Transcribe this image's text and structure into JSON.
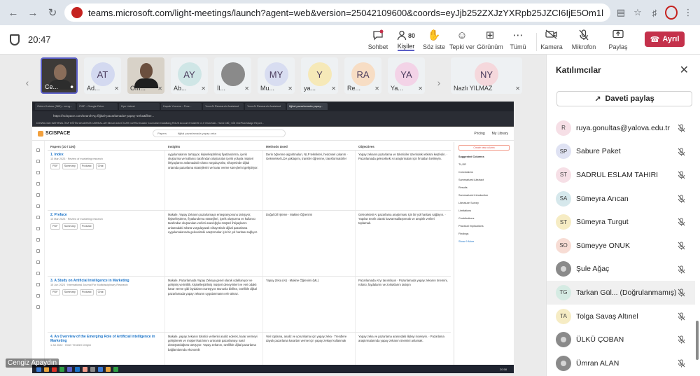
{
  "browser": {
    "url": "teams.microsoft.com/light-meetings/launch?agent=web&version=25042109600&coords=eyJjb252ZXJzYXRpb25JZCI6IjE5Om1lZXRpbmdfWkRVeU1qUTNPRFFF..."
  },
  "toolbar": {
    "timer": "20:47",
    "chat": "Sohbet",
    "people": "Kişiler",
    "people_count": "80",
    "raise": "Söz iste",
    "react": "Tepki ver",
    "view": "Görünüm",
    "more": "Tümü",
    "camera": "Kamera",
    "mic": "Mikrofon",
    "share": "Paylaş",
    "leave": "Ayrıl"
  },
  "strip": [
    {
      "initials": "",
      "name": "Ce...",
      "video": true
    },
    {
      "initials": "AT",
      "name": "Ad...",
      "color": "#d3d9f0"
    },
    {
      "initials": "",
      "name": "Om...",
      "video": true
    },
    {
      "initials": "AY",
      "name": "Ab...",
      "color": "#cfe6e6"
    },
    {
      "initials": "",
      "name": "İl...",
      "photo": true
    },
    {
      "initials": "MY",
      "name": "Mu...",
      "color": "#d8ddf1"
    },
    {
      "initials": "Y",
      "name": "ya...",
      "color": "#f6e9b8"
    },
    {
      "initials": "RA",
      "name": "Re...",
      "color": "#f7ddc4"
    },
    {
      "initials": "YA",
      "name": "Ya...",
      "color": "#f3d3e7"
    }
  ],
  "strip_big": {
    "initials": "NY",
    "name": "Nazlı YILMAZ",
    "color": "#f5d8dc"
  },
  "shared_screen": {
    "presenter": "Cengiz Apaydın",
    "tabs": [
      "Gelen Kutusu (365) - ceng...",
      "İTAP - Google Drive",
      "Üye Listesi",
      "Kapak Yorumu - Pow...",
      "Your AI Research Assistant",
      "Your AI Research Assistant",
      "fiğital pazarlamada yapay..."
    ],
    "address": "https://scispace.com/search?q=fiğital+pazarlamada+yapay+zeka&filter...",
    "bookmarks": "DOWNLOAD   MATERIAL   İTAP   EĞİTİM   AKADEMİK   UMREAL-AR   Mimari   Anket   İhl   AR   CAYRA   Disaster Journalism   DataBang   RGUS Account   EmailOS v1.0   VirusTotal - Home   CBİ | GİS   OnePlusVoltage Report...",
    "logo": "SCISPACE",
    "search_scope": "Papers",
    "query": "fiğital pazarlamada yapay zeka",
    "pricing": "Pricing",
    "library": "My Library",
    "col_papers": "Papers (10 / 100)",
    "col_insights": "Insights",
    "col_methods": "Methods Used",
    "col_objectives": "Objectives",
    "rows": [
      {
        "title": "1. Index",
        "meta": "13 Mar 2023 · Review of marketing research",
        "insight": "uygulamalarını tartışıyor, kişiselleştirilmiş fiyatlandırma, içerik oluşturma ve kullanıcı tarafından oluşturulan içerik yoluyla müşteri ihtiyaçlarını anlamadaki rolünü vurguluyorlar, nihayetinde dijital ortamda pazarlama stratejilerini ve karar verme süreçlerini geliştiriyor.",
        "methods": "Derin öğrenme algoritmaları, NLP teknikleri, hedonsel çıkarım · Geleneksel LDA yaklaşımı, transfer öğrenme, transformatörler",
        "objectives": "Yapay zekanın pazarlama ve tüketiciler üzerindeki etkisini keşfedin. · Pazarlamada gelecekteki AI araştırmaları için fırsatları belirleyin."
      },
      {
        "title": "2. Preface",
        "meta": "13 Mar 2023 · Review of marketing research",
        "insight": "Makale, Yapay Zekanın pazarlamaya entegrasyonunu tartışıyor, kişiselleştirme, fiyatlandırma stratejileri, içerik oluşturma ve kullanıcı tarafından oluşturulan verileri aracılığıyla müşteri ihtiyaçlarını anlamadaki rolünü vurgulayarak nihayetinde dijital pazarlama uygulamalarında gelecekteki araştırmalar için bir yol haritası sağlıyor.",
        "methods": "Doğal Dil İşleme · Makine Öğrenimi",
        "objectives": "Gelecekteki AI pazarlama araştırması için bir yol haritası sağlayın. · Yapılan teorik olarak kavramsallaştırmak ve ampirik verileri toplamak."
      },
      {
        "title": "3. A Study on Artificial Intelligence in Marketing",
        "meta": "15 Jun 2023 · International Journal For Multidisciplinary Research",
        "insight": "Makale, Pazarlamada Yapay Zekaya genel olarak odaklanıyor ve gelişmiş verimlilik, kişiselleştirilmiş müşteri deneyimleri ve veri odaklı karar verme gibi faydalarını tartışıyor. Bununla birlikte, özellikle dijital pazarlamada yapay zekanın uygulanmasını ele almaz.",
        "methods": "Yapay Zeka (AI) · Makine Öğrenimi (ML)",
        "objectives": "Pazarlamada AI'yı tanımlayın · Pazarlamada yapay zekanın önemini, rolünü, faydalarını ve zorluklarını tartışın"
      },
      {
        "title": "4. An Overview of the Emerging Role of Artificial Intelligence in Marketing",
        "meta": "1 Jul 2022 · Ömer Yeneleri Dergisi",
        "insight": "Makale, yapay zekanın tüketici verilerini analiz ederek, karar vermeyi geliştirerek ve müşteri katılımını artırarak pazarlamayı nasıl dönüştürdüğünü tartışıyor. Yapay zekanın, özellikle dijital pazarlama bağlamlarında ekonomik",
        "methods": "Veri toplama, analiz ve yorumlama için yapay zeka · Trendlere dayalı pazarlama kararları verme için yapay zekayı kullanmak",
        "objectives": "Yapay zeka ve pazarlama arasındaki ilişkiyi inceleyin. · Pazarlama araştırmalarında yapay zekanın önemini anlamak."
      }
    ],
    "paper_buttons": [
      "PDF",
      "Summary",
      "Podcast",
      "Chat"
    ],
    "create_column": "Create new column",
    "suggested": "Suggested Columns",
    "side_items": [
      "TL;DR",
      "Conclusions",
      "Summarized Abstract",
      "Results",
      "Summarized Introduction",
      "Literature Survey",
      "Limitations",
      "Contributions",
      "Practical Implications",
      "Findings"
    ],
    "show_more": "Show 9 More",
    "clock": "20:58"
  },
  "panel": {
    "title": "Katılımcılar",
    "invite": "Daveti paylaş",
    "participants": [
      {
        "initials": "R",
        "name": "ruya.gonultas@yalova.edu.tr",
        "color": "#f6dfe6"
      },
      {
        "initials": "SP",
        "name": "Sabure Paket",
        "color": "#dfe2f3"
      },
      {
        "initials": "ST",
        "name": "SADRUL ESLAM TAHIRI",
        "color": "#f6dfe6"
      },
      {
        "initials": "SA",
        "name": "Sümeyra Arıcan",
        "color": "#d6e8ec"
      },
      {
        "initials": "ST",
        "name": "Sümeyra Turgut",
        "color": "#f6ecc4"
      },
      {
        "initials": "SO",
        "name": "Sümeyye ONUK",
        "color": "#f7dcd4"
      },
      {
        "initials": "",
        "name": "Şule Ağaç",
        "photo": true
      },
      {
        "initials": "TG",
        "name": "Tarkan Gül...   (Doğrulanmamış)",
        "color": "#d5ebe3",
        "highlight": true
      },
      {
        "initials": "TA",
        "name": "Tolga Savaş Altınel",
        "color": "#f6ecc4"
      },
      {
        "initials": "",
        "name": "ÜLKÜ ÇOBAN",
        "photo": true
      },
      {
        "initials": "",
        "name": "Ümran ALAN",
        "photo": true
      }
    ]
  },
  "colors": {
    "leave": "#c4314b",
    "accent": "#5b5fc7",
    "link": "#1a73c8"
  }
}
